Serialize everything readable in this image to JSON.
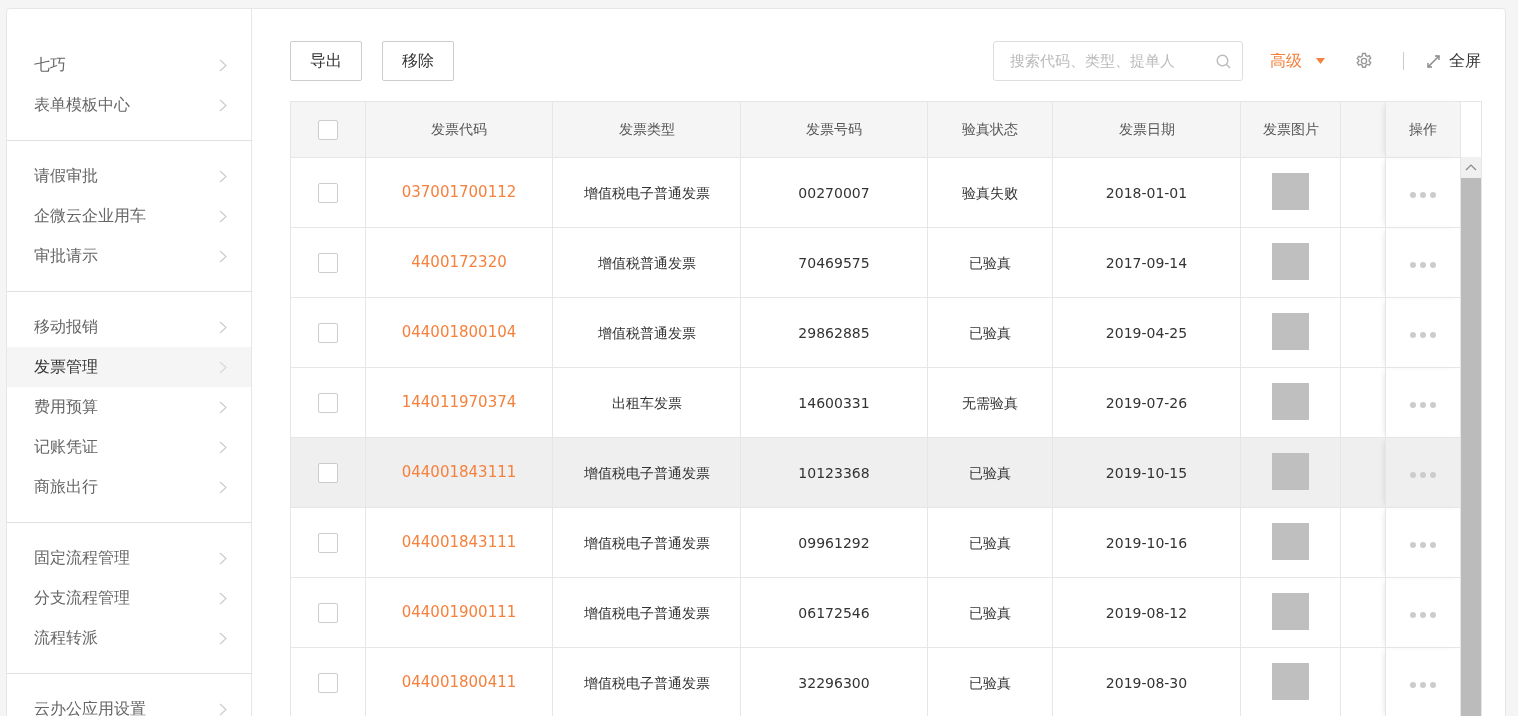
{
  "sidebar": {
    "groups": [
      {
        "items": [
          {
            "label": "七巧",
            "selected": false
          },
          {
            "label": "表单模板中心",
            "selected": false
          }
        ]
      },
      {
        "items": [
          {
            "label": "请假审批",
            "selected": false
          },
          {
            "label": "企微云企业用车",
            "selected": false
          },
          {
            "label": "审批请示",
            "selected": false
          }
        ]
      },
      {
        "items": [
          {
            "label": "移动报销",
            "selected": false
          },
          {
            "label": "发票管理",
            "selected": true
          },
          {
            "label": "费用预算",
            "selected": false
          },
          {
            "label": "记账凭证",
            "selected": false
          },
          {
            "label": "商旅出行",
            "selected": false
          }
        ]
      },
      {
        "items": [
          {
            "label": "固定流程管理",
            "selected": false
          },
          {
            "label": "分支流程管理",
            "selected": false
          },
          {
            "label": "流程转派",
            "selected": false
          }
        ]
      },
      {
        "items": [
          {
            "label": "云办公应用设置",
            "selected": false
          }
        ]
      }
    ]
  },
  "toolbar": {
    "buttons": [
      "导出",
      "移除"
    ],
    "search": {
      "placeholder": "搜索代码、类型、提单人"
    },
    "advanced": "高级",
    "fullscreen": "全屏"
  },
  "table": {
    "header_checked": false,
    "columns": [
      "发票代码",
      "发票类型",
      "发票号码",
      "验真状态",
      "发票日期",
      "发票图片",
      "操作"
    ],
    "rows": [
      {
        "checked": false,
        "highlighted": false,
        "code": "037001700112",
        "type": "增值税电子普通发票",
        "number": "00270007",
        "status": "验真失败",
        "date": "2018-01-01"
      },
      {
        "checked": false,
        "highlighted": false,
        "code": "4400172320",
        "type": "增值税普通发票",
        "number": "70469575",
        "status": "已验真",
        "date": "2017-09-14"
      },
      {
        "checked": false,
        "highlighted": false,
        "code": "044001800104",
        "type": "增值税普通发票",
        "number": "29862885",
        "status": "已验真",
        "date": "2019-04-25"
      },
      {
        "checked": false,
        "highlighted": false,
        "code": "144011970374",
        "type": "出租车发票",
        "number": "14600331",
        "status": "无需验真",
        "date": "2019-07-26"
      },
      {
        "checked": false,
        "highlighted": true,
        "code": "044001843111",
        "type": "增值税电子普通发票",
        "number": "10123368",
        "status": "已验真",
        "date": "2019-10-15"
      },
      {
        "checked": false,
        "highlighted": false,
        "code": "044001843111",
        "type": "增值税电子普通发票",
        "number": "09961292",
        "status": "已验真",
        "date": "2019-10-16"
      },
      {
        "checked": false,
        "highlighted": false,
        "code": "044001900111",
        "type": "增值税电子普通发票",
        "number": "06172546",
        "status": "已验真",
        "date": "2019-08-12"
      },
      {
        "checked": false,
        "highlighted": false,
        "code": "044001800411",
        "type": "增值税电子普通发票",
        "number": "32296300",
        "status": "已验真",
        "date": "2019-08-30"
      }
    ]
  }
}
